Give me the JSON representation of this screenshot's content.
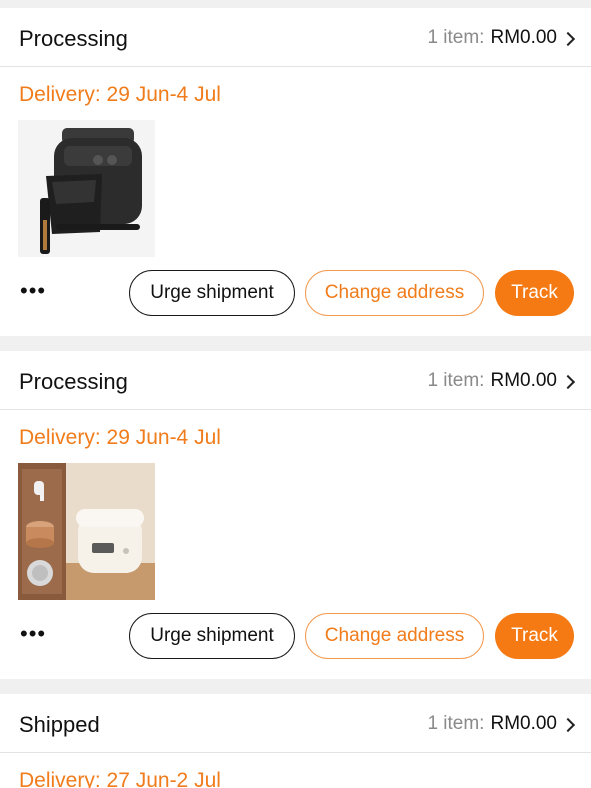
{
  "orders": [
    {
      "status": "Processing",
      "item_count": "1 item:",
      "amount": "RM0.00",
      "delivery": "Delivery: 29 Jun-4 Jul",
      "product_image": "air-fryer",
      "more": "•••",
      "urge_label": "Urge shipment",
      "change_address_label": "Change address",
      "track_label": "Track"
    },
    {
      "status": "Processing",
      "item_count": "1 item:",
      "amount": "RM0.00",
      "delivery": "Delivery: 29 Jun-4 Jul",
      "product_image": "rice-cooker",
      "more": "•••",
      "urge_label": "Urge shipment",
      "change_address_label": "Change address",
      "track_label": "Track"
    },
    {
      "status": "Shipped",
      "item_count": "1 item:",
      "amount": "RM0.00",
      "delivery": "Delivery: 27 Jun-2 Jul"
    }
  ],
  "colors": {
    "accent": "#f67a13",
    "delivery_text": "#f07c1b",
    "background": "#f0f0f0"
  }
}
